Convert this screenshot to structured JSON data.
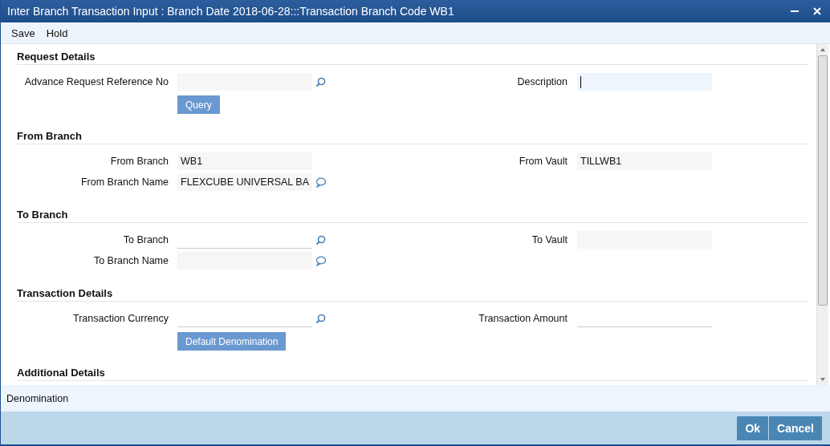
{
  "window": {
    "title": "Inter Branch Transaction Input : Branch Date 2018-06-28:::Transaction Branch Code WB1"
  },
  "menu": [
    "Save",
    "Hold"
  ],
  "sections": [
    {
      "title": "Request Details",
      "rows": [
        {
          "left": {
            "label": "Advance Request Reference No",
            "readonly": true,
            "kind": "lookup"
          },
          "right": {
            "label": "Description",
            "focused": true
          }
        }
      ],
      "buttons": [
        "Query"
      ]
    },
    {
      "title": "From Branch",
      "rows": [
        {
          "left": {
            "label": "From Branch",
            "value": "WB1",
            "readonly": true
          },
          "right": {
            "label": "From Vault",
            "value": "TILLWB1",
            "readonly": true
          }
        },
        {
          "left": {
            "label": "From Branch Name",
            "value": "FLEXCUBE UNIVERSAL BA",
            "readonly": true,
            "kind": "note"
          }
        }
      ]
    },
    {
      "title": "To Branch",
      "rows": [
        {
          "left": {
            "label": "To Branch",
            "readonly": false,
            "kind": "lookup"
          },
          "right": {
            "label": "To Vault",
            "readonly": true
          }
        },
        {
          "left": {
            "label": "To Branch Name",
            "readonly": true,
            "kind": "note"
          }
        }
      ]
    },
    {
      "title": "Transaction Details",
      "rows": [
        {
          "left": {
            "label": "Transaction Currency",
            "readonly": false,
            "kind": "lookup"
          },
          "right": {
            "label": "Transaction Amount",
            "readonly": false
          }
        }
      ],
      "buttons": [
        "Default Denomination"
      ]
    },
    {
      "title": "Additional Details"
    }
  ],
  "bottom_tabs": [
    "Denomination"
  ],
  "footer_buttons": [
    "Ok",
    "Cancel"
  ]
}
